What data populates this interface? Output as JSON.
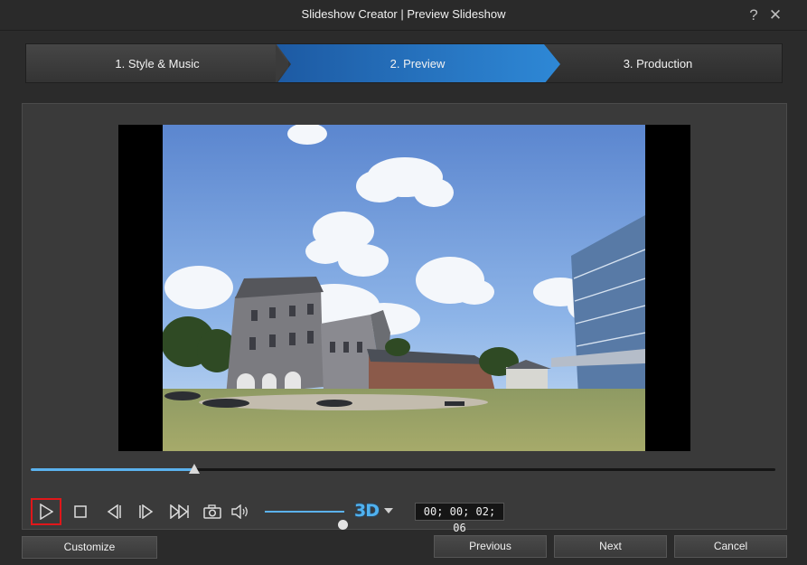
{
  "window": {
    "title": "Slideshow Creator | Preview Slideshow",
    "help_glyph": "?",
    "close_glyph": "✕"
  },
  "steps": [
    {
      "label": "1. Style & Music",
      "active": false
    },
    {
      "label": "2. Preview",
      "active": true
    },
    {
      "label": "3. Production",
      "active": false
    }
  ],
  "player": {
    "seek_progress": 0.22,
    "volume_level": 0.98,
    "mode_3d_label": "3D",
    "timecode": "00; 00; 02; 06",
    "icons": [
      "play-icon",
      "stop-icon",
      "previous-frame-icon",
      "next-frame-icon",
      "fast-forward-icon",
      "camera-icon",
      "speaker-icon"
    ],
    "accent_color": "#5bb2ee"
  },
  "buttons": {
    "customize": "Customize",
    "previous": "Previous",
    "next": "Next",
    "cancel": "Cancel"
  },
  "colors": {
    "active_step": "#2e88d6",
    "play_highlight": "#e0171a"
  }
}
